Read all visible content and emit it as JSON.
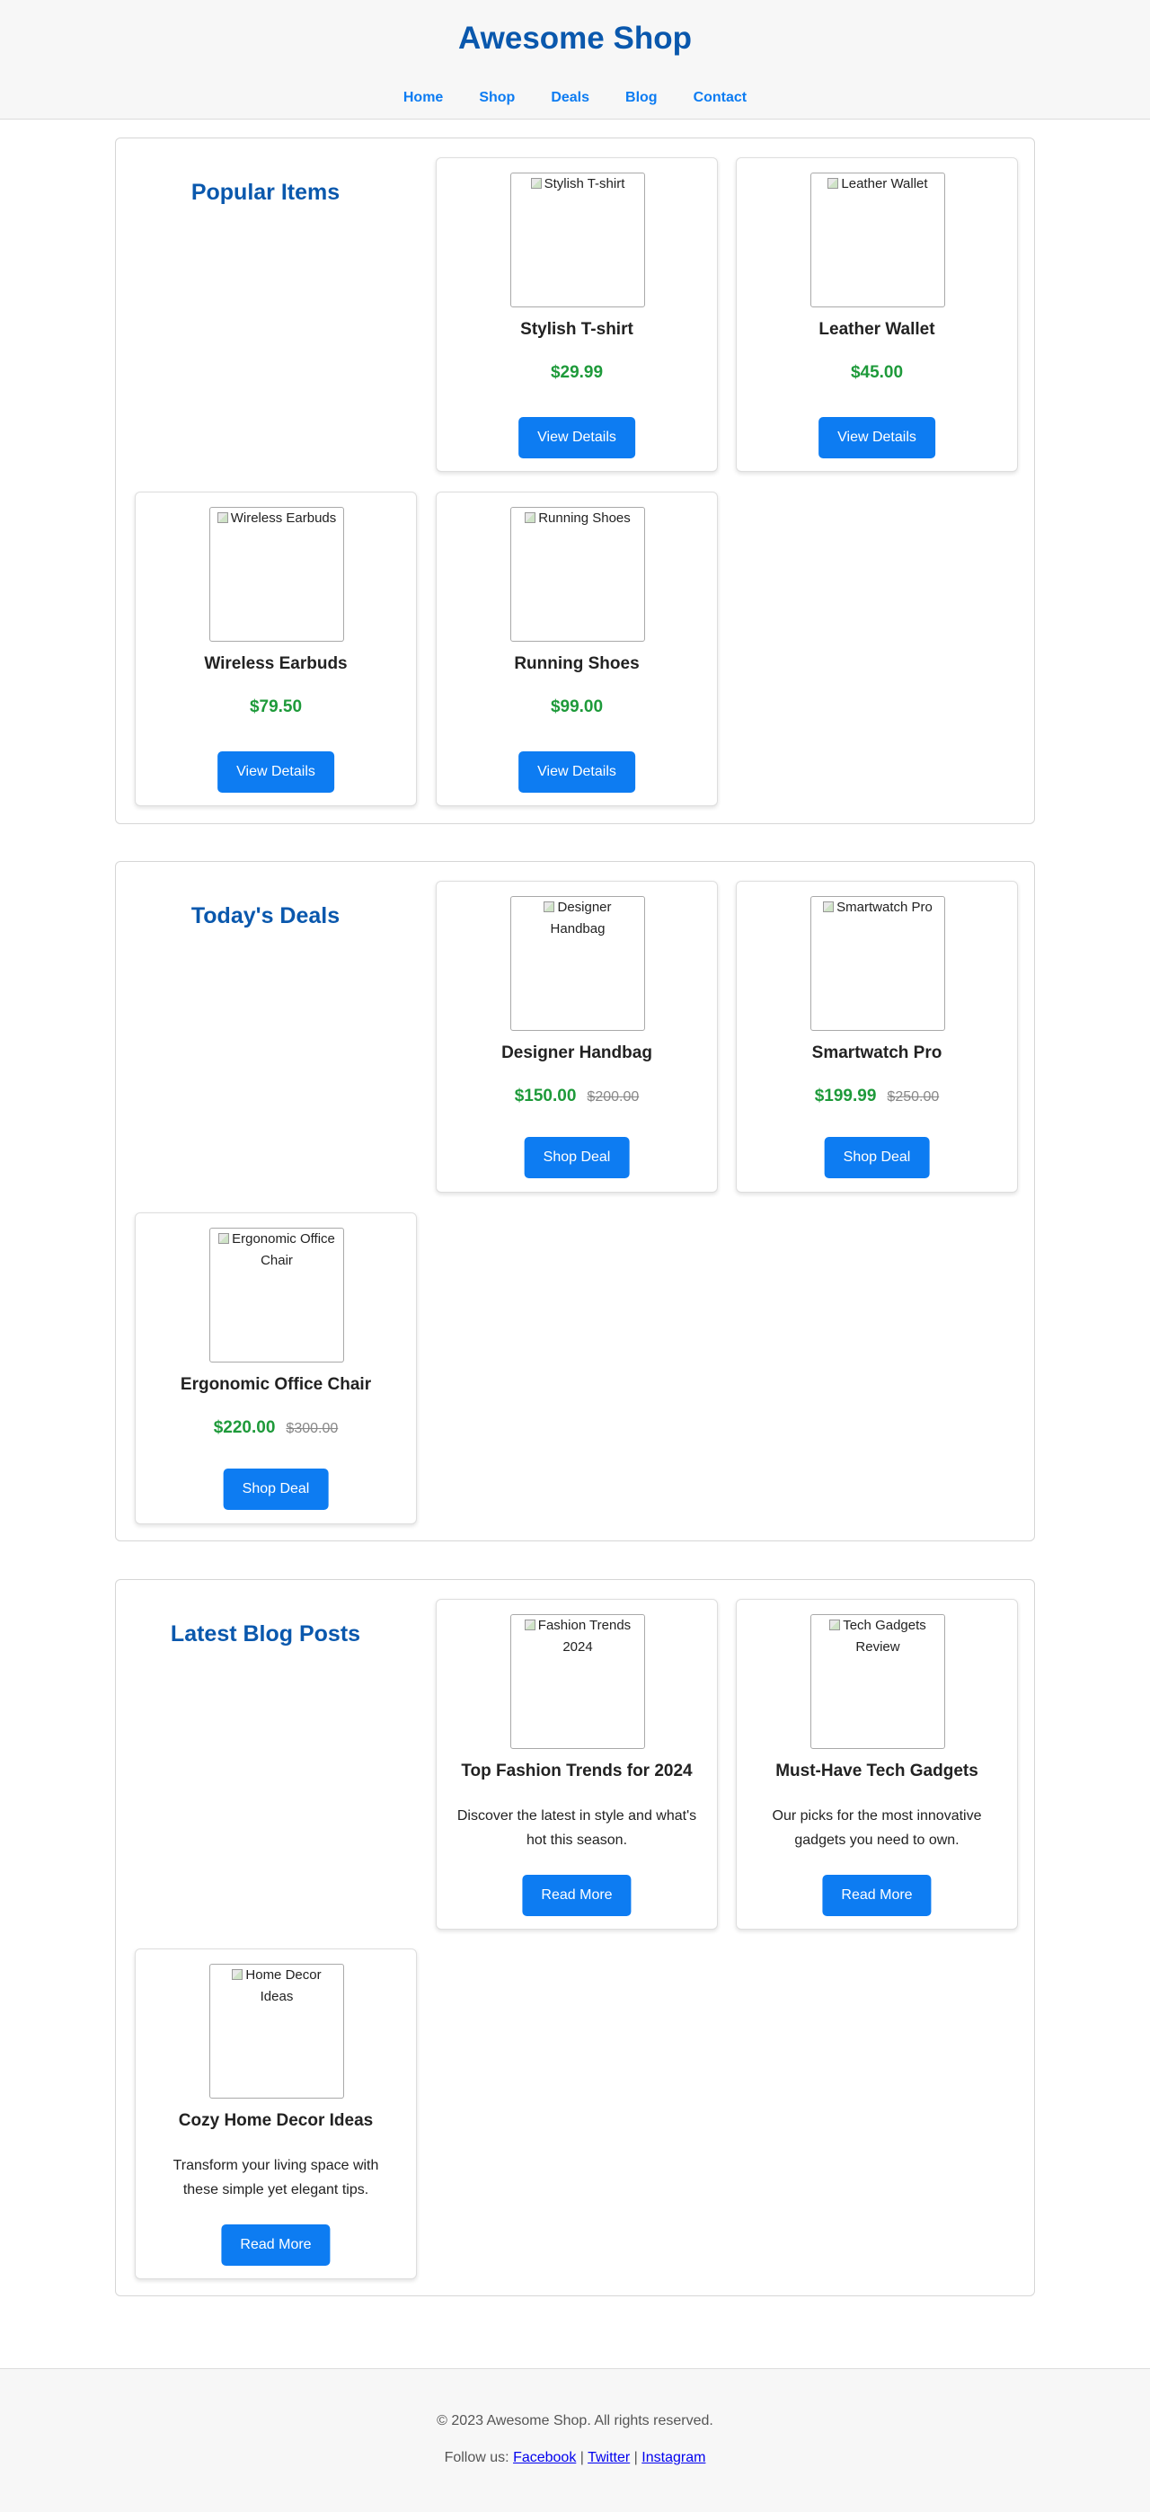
{
  "header": {
    "title": "Awesome Shop",
    "nav": [
      "Home",
      "Shop",
      "Deals",
      "Blog",
      "Contact"
    ]
  },
  "popular": {
    "title": "Popular Items",
    "items": [
      {
        "alt": "Stylish T-shirt",
        "name": "Stylish T-shirt",
        "price": "$29.99",
        "button": "View Details"
      },
      {
        "alt": "Leather Wallet",
        "name": "Leather Wallet",
        "price": "$45.00",
        "button": "View Details"
      },
      {
        "alt": "Wireless Earbuds",
        "name": "Wireless Earbuds",
        "price": "$79.50",
        "button": "View Details"
      },
      {
        "alt": "Running Shoes",
        "name": "Running Shoes",
        "price": "$99.00",
        "button": "View Details"
      }
    ]
  },
  "deals": {
    "title": "Today's Deals",
    "items": [
      {
        "alt": "Designer Handbag",
        "name": "Designer Handbag",
        "price": "$150.00",
        "old_price": "$200.00",
        "button": "Shop Deal"
      },
      {
        "alt": "Smartwatch Pro",
        "name": "Smartwatch Pro",
        "price": "$199.99",
        "old_price": "$250.00",
        "button": "Shop Deal"
      },
      {
        "alt": "Ergonomic Office Chair",
        "name": "Ergonomic Office Chair",
        "price": "$220.00",
        "old_price": "$300.00",
        "button": "Shop Deal"
      }
    ]
  },
  "blog": {
    "title": "Latest Blog Posts",
    "items": [
      {
        "alt": "Fashion Trends 2024",
        "name": "Top Fashion Trends for 2024",
        "desc": "Discover the latest in style and what's hot this season.",
        "button": "Read More"
      },
      {
        "alt": "Tech Gadgets Review",
        "name": "Must-Have Tech Gadgets",
        "desc": "Our picks for the most innovative gadgets you need to own.",
        "button": "Read More"
      },
      {
        "alt": "Home Decor Ideas",
        "name": "Cozy Home Decor Ideas",
        "desc": "Transform your living space with these simple yet elegant tips.",
        "button": "Read More"
      }
    ]
  },
  "footer": {
    "copyright": "© 2023 Awesome Shop. All rights reserved.",
    "follow_label": "Follow us:",
    "social": [
      "Facebook",
      "Twitter",
      "Instagram"
    ],
    "separator": "|"
  },
  "colors": {
    "brand": "#0a58ad",
    "accent": "#0d7cf2",
    "price": "#1e9a3a"
  }
}
